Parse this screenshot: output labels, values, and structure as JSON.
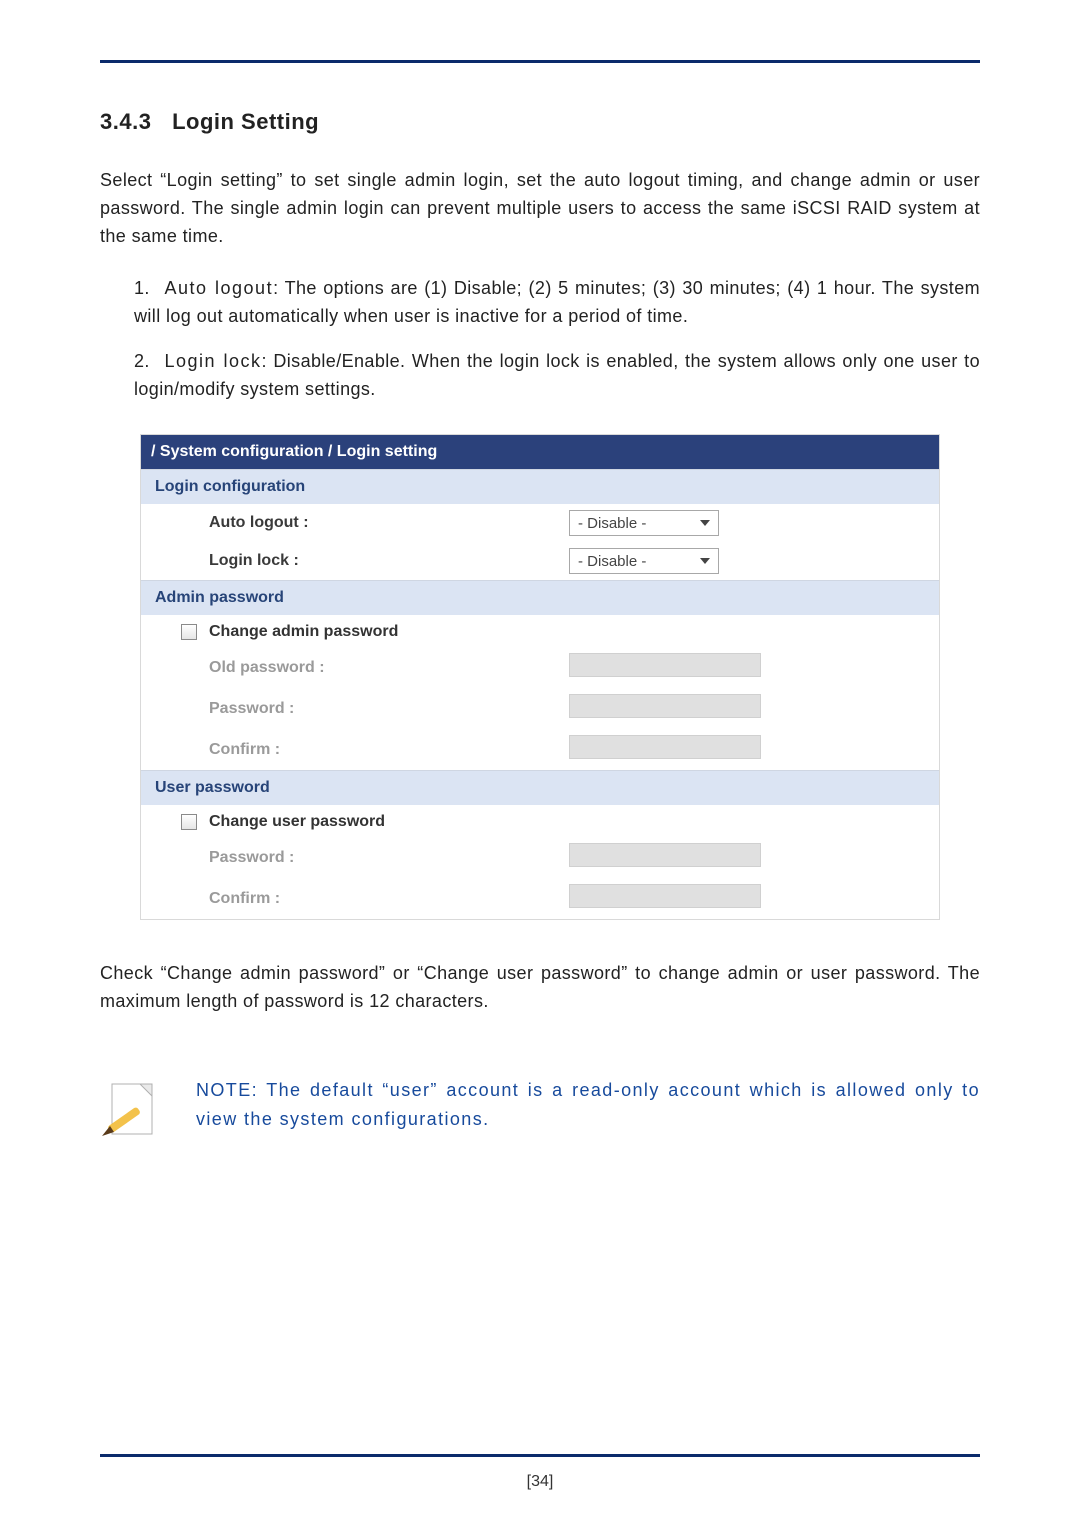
{
  "heading": {
    "num": "3.4.3",
    "title": "Login Setting"
  },
  "intro": "Select “Login setting” to set single admin login, set the auto logout timing, and change admin or user password. The single admin login can prevent multiple users to access the same iSCSI RAID system at the same time.",
  "items": [
    {
      "num": "1.",
      "key": "Auto logout",
      "text": ": The options are (1) Disable; (2) 5 minutes; (3) 30 minutes; (4) 1 hour. The system will log out automatically when user is inactive for a period of time."
    },
    {
      "num": "2.",
      "key": "Login lock",
      "text": ": Disable/Enable. When the login lock is enabled, the system allows only one user to login/modify system settings."
    }
  ],
  "ui": {
    "breadcrumb": "/ System configuration / Login setting",
    "loginConfig": {
      "title": "Login configuration",
      "autoLogoutLabel": "Auto logout :",
      "autoLogoutValue": "- Disable -",
      "loginLockLabel": "Login lock :",
      "loginLockValue": "- Disable -"
    },
    "adminPwd": {
      "title": "Admin password",
      "changeLabel": "Change admin password",
      "oldLabel": "Old password :",
      "pwdLabel": "Password :",
      "confirmLabel": "Confirm :"
    },
    "userPwd": {
      "title": "User password",
      "changeLabel": "Change user password",
      "pwdLabel": "Password :",
      "confirmLabel": "Confirm :"
    }
  },
  "afterText": "Check “Change admin password” or “Change user password” to change admin or user password. The maximum length of password is 12 characters.",
  "note": "NOTE: The default “user” account is a read-only account which is allowed only to view the system configurations.",
  "pageNumber": "[34]"
}
